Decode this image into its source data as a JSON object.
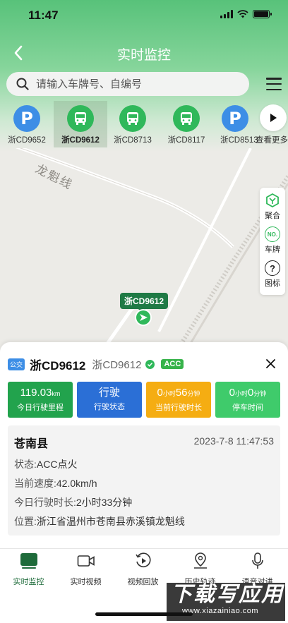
{
  "status_bar": {
    "time": "11:47"
  },
  "nav": {
    "title": "实时监控"
  },
  "search": {
    "placeholder": "请输入车牌号、自编号"
  },
  "vehicles": [
    {
      "label": "浙CD9652",
      "icon": "parking-icon"
    },
    {
      "label": "浙CD9612",
      "icon": "bus-icon",
      "selected": true
    },
    {
      "label": "浙CD8713",
      "icon": "bus-icon"
    },
    {
      "label": "浙CD8117",
      "icon": "bus-icon"
    },
    {
      "label": "浙CD8513",
      "icon": "parking-icon"
    }
  ],
  "more_label": "查看更多",
  "map": {
    "road_name": "龙魁线",
    "tools": [
      {
        "label": "聚合",
        "icon": "cluster-icon"
      },
      {
        "label": "车牌",
        "icon": "plate-icon",
        "icon_text": "NO."
      },
      {
        "label": "图标",
        "icon": "question-icon"
      }
    ],
    "car_tag": "浙CD9612"
  },
  "detail": {
    "type_badge": "公交",
    "plate": "浙CD9612",
    "plate_sub": "浙CD9612",
    "acc": "ACC",
    "stats": [
      {
        "value": "119.03",
        "unit": "km",
        "label": "今日行驶里程",
        "color": "#22a34d"
      },
      {
        "value": "行驶",
        "label": "行驶状态",
        "color": "#2b6fd6"
      },
      {
        "v1": "0",
        "u1": "小时",
        "v2": "56",
        "u2": "分钟",
        "label": "当前行驶时长",
        "color": "#f5ad12"
      },
      {
        "v1": "0",
        "u1": "小时",
        "v2": "0",
        "u2": "分钟",
        "label": "停车时间",
        "color": "#3fcb6b"
      }
    ],
    "info": {
      "title": "苍南县",
      "time": "2023-7-8 11:47:53",
      "rows": [
        {
          "key": "状态:",
          "value": "ACC点火"
        },
        {
          "key": "当前速度:",
          "value": "42.0km/h"
        },
        {
          "key": "今日行驶时长:",
          "value": "2小时33分钟"
        },
        {
          "key": "位置:",
          "value": "浙江省温州市苍南县赤溪镇龙魁线"
        }
      ]
    }
  },
  "tabs": [
    {
      "label": "实时监控",
      "icon": "monitor-icon",
      "active": true
    },
    {
      "label": "实时视频",
      "icon": "video-icon"
    },
    {
      "label": "视频回放",
      "icon": "playback-icon"
    },
    {
      "label": "历史轨迹",
      "icon": "track-icon"
    },
    {
      "label": "语音对讲",
      "icon": "microphone-icon"
    }
  ],
  "watermark": {
    "main": "下载写应用",
    "sub": "www.xiazainiao.com"
  },
  "colors": {
    "primary": "#22a34d",
    "accent_blue": "#2b6fd6",
    "accent_orange": "#f5ad12"
  }
}
